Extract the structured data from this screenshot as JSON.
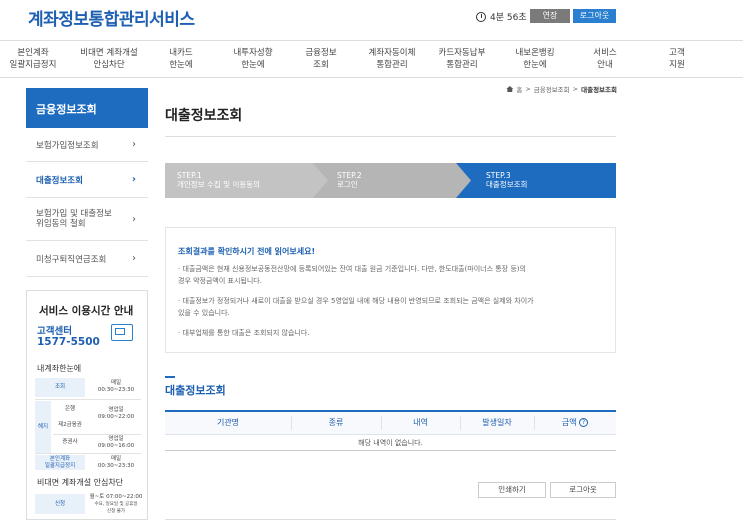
{
  "header": {
    "title": "계좌정보통합관리서비스",
    "timer": "4분 56초",
    "extend_label": "연장",
    "logout_label": "로그아웃"
  },
  "nav": {
    "items": [
      {
        "line1": "본인계좌",
        "line2": "일괄지급정지"
      },
      {
        "line1": "비대면 계좌개설",
        "line2": "안심차단"
      },
      {
        "line1": "내카드",
        "line2": "한눈에"
      },
      {
        "line1": "내투자성향",
        "line2": "한눈에"
      },
      {
        "line1": "금융정보",
        "line2": "조회"
      },
      {
        "line1": "계좌자동이체",
        "line2": "통합관리"
      },
      {
        "line1": "카드자동납부",
        "line2": "통합관리"
      },
      {
        "line1": "내보온뱅킹",
        "line2": "한눈에"
      },
      {
        "line1": "서비스",
        "line2": "안내"
      },
      {
        "line1": "고객",
        "line2": "지원"
      }
    ]
  },
  "breadcrumb": {
    "home": "홈",
    "sep": ">",
    "parent": "금융정보조회",
    "current": "대출정보조회"
  },
  "sidebar": {
    "title": "금융정보조회",
    "chevron": "›",
    "items": [
      {
        "label": "보험가입정보조회"
      },
      {
        "label": "대출정보조회"
      },
      {
        "label": "보험가입 및 대출정보",
        "label2": "위임동의 철회"
      },
      {
        "label": "미청구퇴직연금조회"
      }
    ]
  },
  "service_info": {
    "title": "서비스 이용시간 안내",
    "center_label": "고객센터",
    "phone": "1577-5500",
    "section1": "내계좌한눈에",
    "rows": {
      "lookup": {
        "cat": "조회",
        "days": "매일",
        "time": "00:30~23:30"
      },
      "close_cat": "해지",
      "bank": {
        "name": "은행",
        "days": "영업일",
        "time": "09:00~22:00"
      },
      "second_tier": {
        "name": "제2금융권"
      },
      "securities": {
        "name": "증권사",
        "days": "영업일",
        "time": "09:00~16:00"
      },
      "stop": {
        "cat1": "본인계좌",
        "cat2": "일괄지급정지",
        "days": "매일",
        "time": "00:30~23:30"
      }
    },
    "section2": "비대면 계좌개설 안심차단",
    "apply": {
      "cat": "신청",
      "time": "월~토 07:00~22:00",
      "note1": "수요, 일요일 및 공휴일",
      "note2": "신청 불가"
    }
  },
  "main": {
    "title": "대출정보조회",
    "steps": [
      {
        "num": "STEP.1",
        "label": "개인정보 수집 및 이용동의"
      },
      {
        "num": "STEP.2",
        "label": "로그인"
      },
      {
        "num": "STEP.3",
        "label": "대출정보조회"
      }
    ],
    "notice": {
      "title": "조회결과를 확인하시기 전에 읽어보세요!",
      "lines": [
        "· 대출금액은 현재 신용정보공동전산망에 등록되어있는 잔여 대출 원금 기준입니다. 다만, 한도대출(마이너스 통장 등)의",
        "  경우 약정금액이 표시됩니다.",
        "· 대출정보가 정정되거나 새로이 대출을 받으실 경우 5영업일 내에 해당 내용이 반영되므로 조회되는 금액은 실제와 차이가",
        "  있을 수 있습니다.",
        "· 대부업체를 통한 대출은 조회되지 않습니다."
      ]
    },
    "section_title": "대출정보조회",
    "table": {
      "headers": [
        "기관명",
        "종류",
        "내역",
        "발생일자",
        "금액"
      ],
      "help": "?",
      "empty": "해당 내역이 없습니다."
    },
    "print_label": "인쇄하기",
    "logout_label": "로그아웃"
  },
  "colors": {
    "primary": "#1d6cc0",
    "step_gray": "#c3c3c3",
    "logo": "#1d5fb0"
  }
}
